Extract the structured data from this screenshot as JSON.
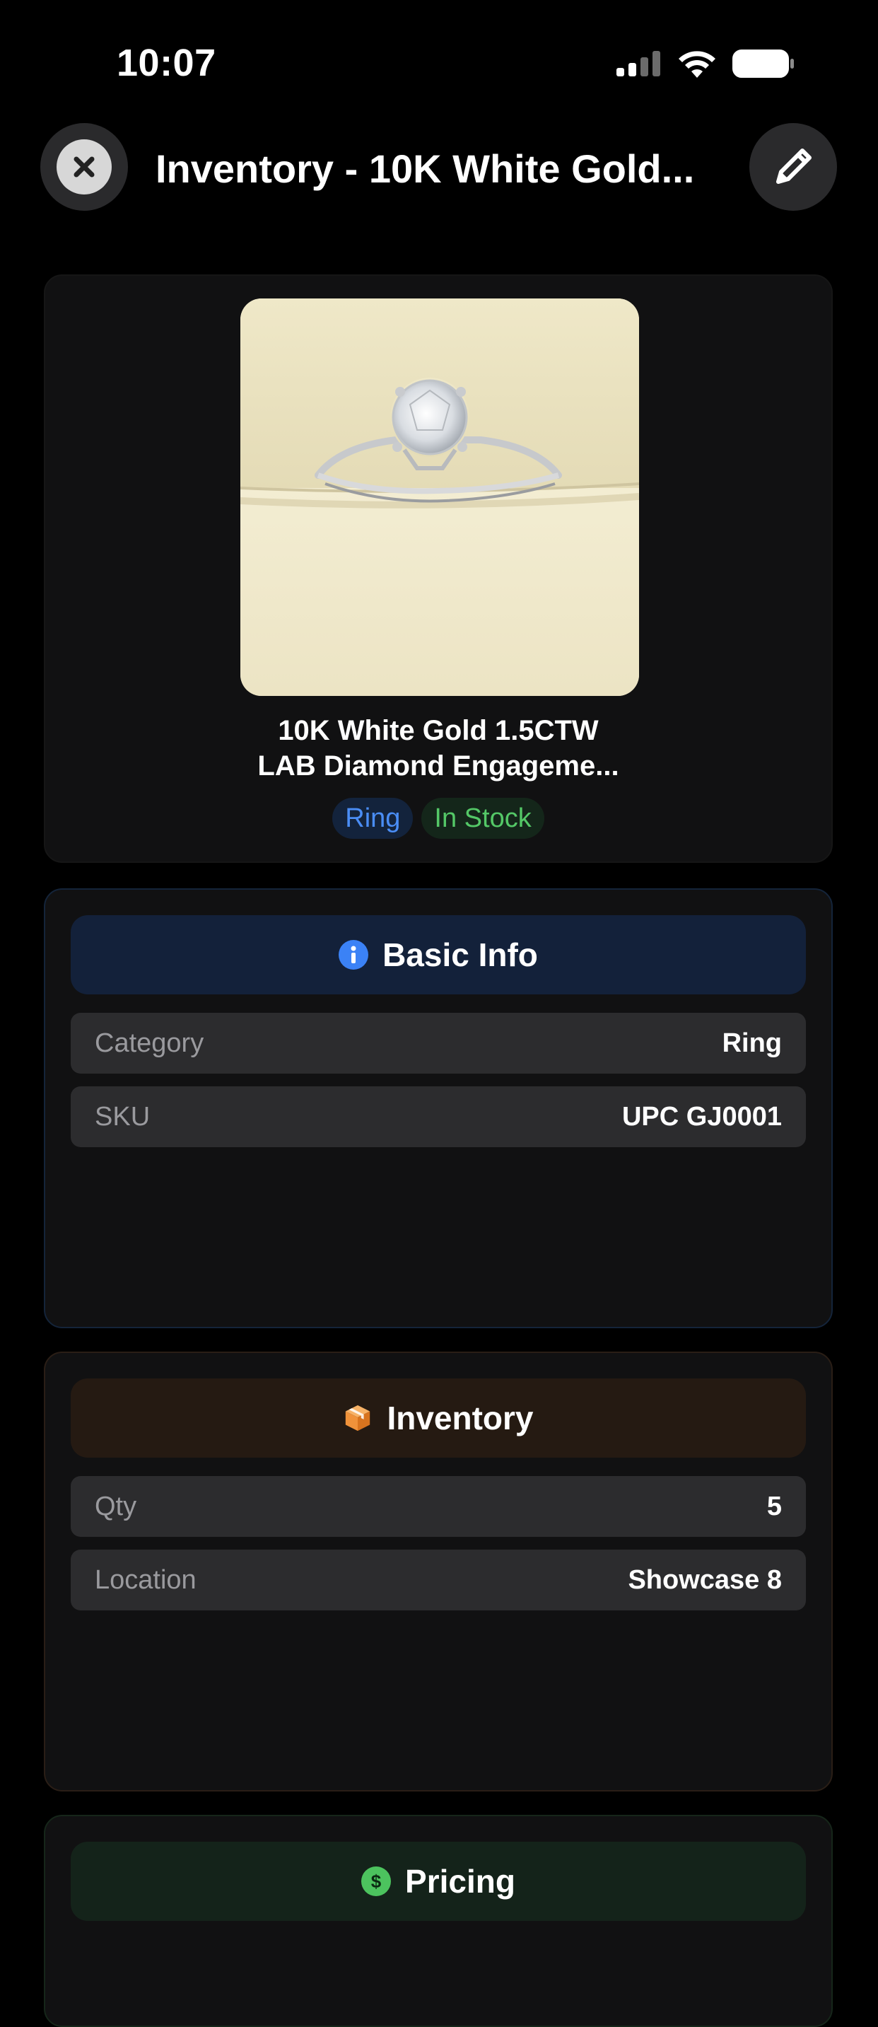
{
  "status_bar": {
    "time": "10:07",
    "icons": [
      "cellular-signal-icon",
      "wifi-icon",
      "battery-icon"
    ]
  },
  "nav": {
    "title": "Inventory - 10K White Gold...",
    "close_icon": "close-icon",
    "edit_icon": "pencil-icon"
  },
  "product": {
    "name_line1": "10K White Gold 1.5CTW",
    "name_line2": "LAB Diamond Engageme...",
    "badges": {
      "type": "Ring",
      "stock": "In Stock"
    }
  },
  "sections": {
    "basic": {
      "title": "Basic Info",
      "icon": "info-icon",
      "accent": "#3b82f6",
      "rows": [
        {
          "label": "Category",
          "value": "Ring"
        },
        {
          "label": "SKU",
          "value": "UPC GJ0001"
        }
      ]
    },
    "inventory": {
      "title": "Inventory",
      "icon": "box-icon",
      "accent": "#f0923a",
      "rows": [
        {
          "label": "Qty",
          "value": "5"
        },
        {
          "label": "Location",
          "value": "Showcase 8"
        }
      ]
    },
    "pricing": {
      "title": "Pricing",
      "icon": "dollar-icon",
      "accent": "#4cc35e"
    }
  }
}
